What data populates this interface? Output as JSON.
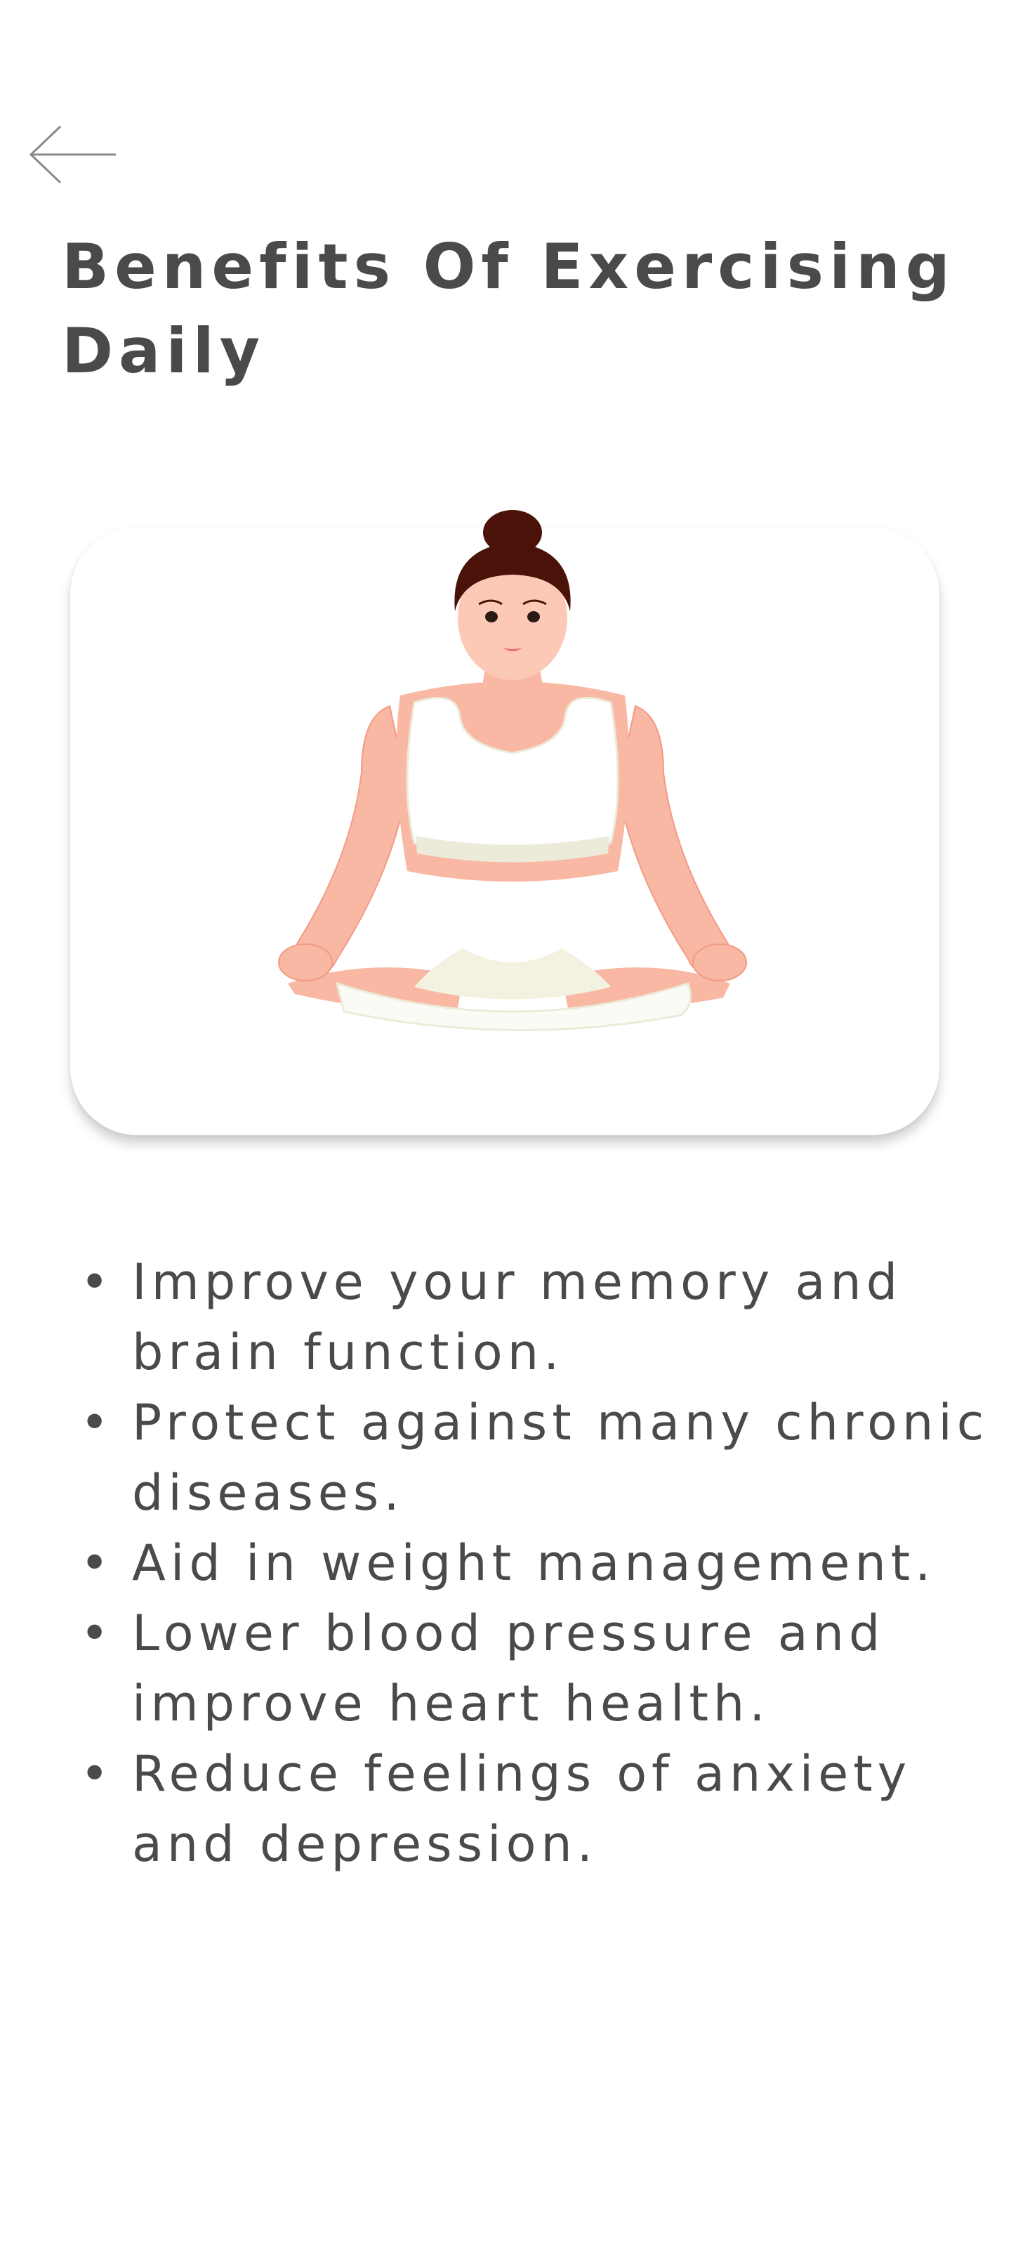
{
  "header": {
    "back_label": "",
    "title": "Benefits Of Exercising Daily"
  },
  "hero": {
    "illustration_icon": "meditating-woman-illustration"
  },
  "benefits": {
    "bullet": "•",
    "items": [
      "Improve your memory and brain function.",
      "Protect against many chronic diseases.",
      "Aid in weight management.",
      "Lower blood pressure and improve heart health.",
      "Reduce feelings of anxiety and depression."
    ]
  },
  "colors": {
    "text": "#4a4a4a",
    "background": "#ffffff",
    "skin": "#f9b8a3",
    "hair": "#4a1208",
    "outfit": "#ffffff"
  }
}
